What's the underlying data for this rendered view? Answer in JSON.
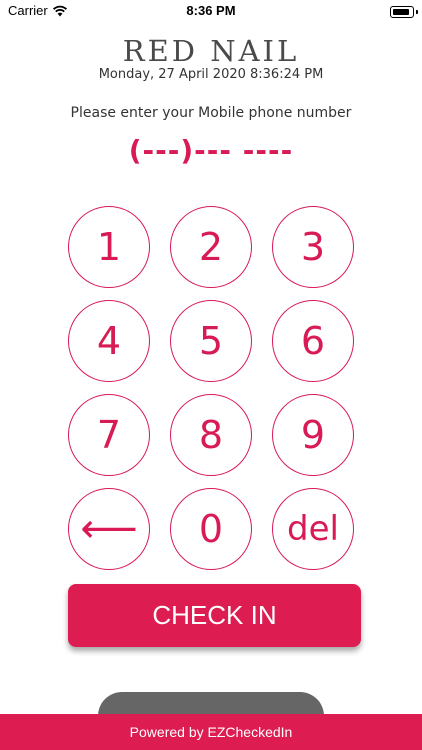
{
  "status_bar": {
    "carrier": "Carrier",
    "time": "8:36 PM",
    "icons": [
      "wifi-icon",
      "battery-icon"
    ]
  },
  "header": {
    "brand": "RED NAIL",
    "datetime": "Monday, 27 April 2020 8:36:24 PM"
  },
  "prompt": "Please enter your Mobile phone number",
  "phone_display": "(---)--- ----",
  "keypad": {
    "k1": "1",
    "k2": "2",
    "k3": "3",
    "k4": "4",
    "k5": "5",
    "k6": "6",
    "k7": "7",
    "k8": "8",
    "k9": "9",
    "back": "⟵",
    "k0": "0",
    "del": "del"
  },
  "actions": {
    "checkin_label": "CHECK IN"
  },
  "footer": {
    "powered_by": "Powered by EZCheckedIn"
  },
  "colors": {
    "accent": "#dd1c52",
    "key_outline": "#d81b55",
    "brand_text": "#4a4a4a"
  }
}
